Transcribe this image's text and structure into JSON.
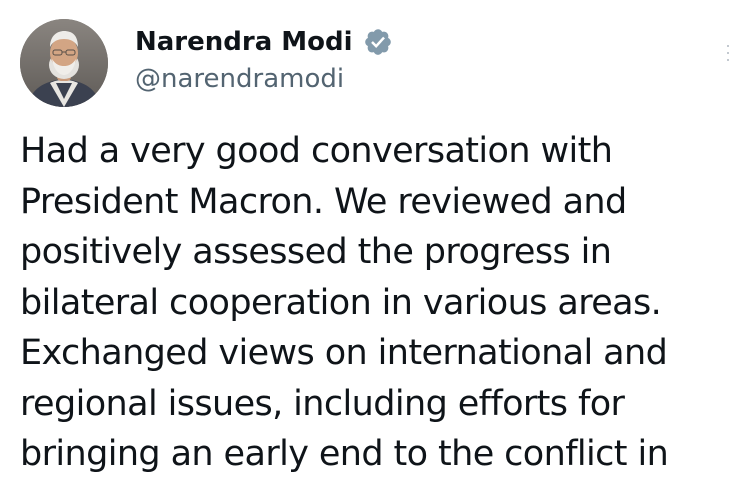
{
  "author": {
    "display_name": "Narendra Modi",
    "handle": "@narendramodi",
    "verified": true,
    "verified_badge_color": "#829aab"
  },
  "tweet": {
    "lines": [
      "Had a very good conversation with",
      "President Macron. We reviewed and",
      "positively assessed the progress in",
      "bilateral cooperation in various areas.",
      "Exchanged views on international and",
      "regional issues, including efforts for",
      "bringing an early end to the conflict in"
    ]
  },
  "icons": {
    "avatar": "profile-photo",
    "badge": "verified-badge-icon",
    "menu": "more-options-icon"
  },
  "colors": {
    "text": "#0f1419",
    "secondary_text": "#536471",
    "background": "#ffffff"
  }
}
